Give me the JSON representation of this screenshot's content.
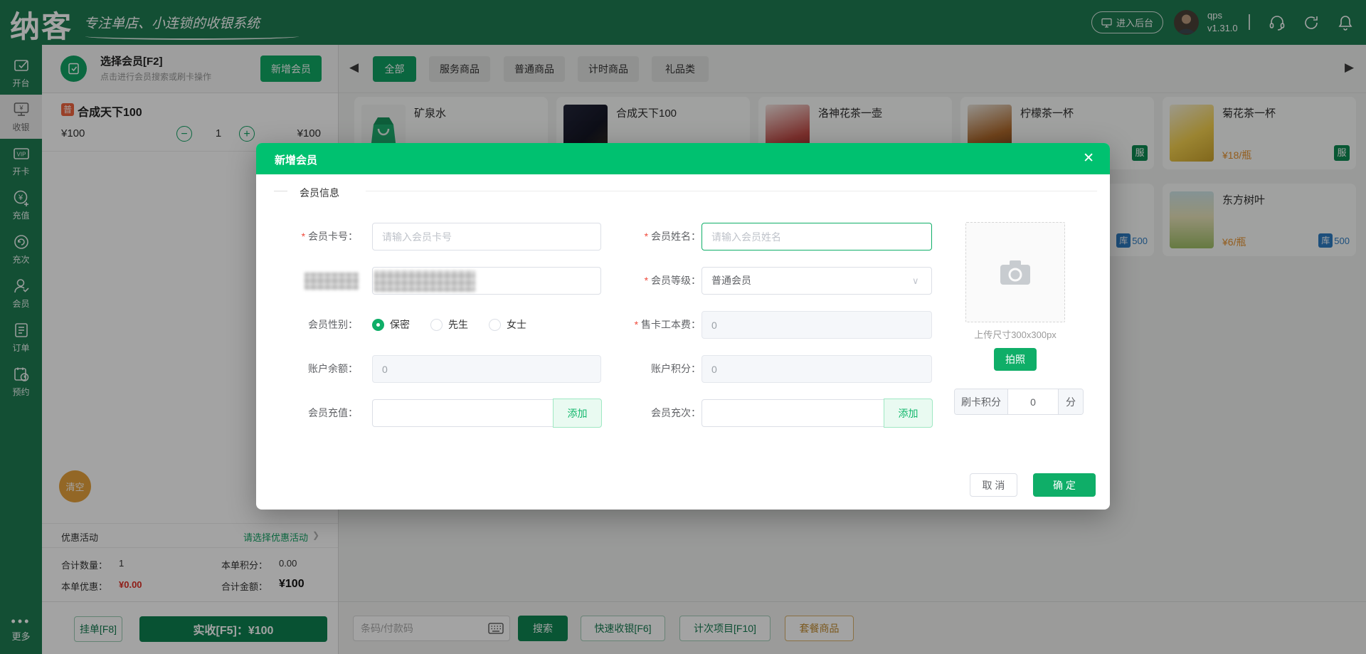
{
  "topbar": {
    "logo": "纳客",
    "tagline": "专注单店、小连锁的收银系统",
    "backstage": "进入后台",
    "user": "qps",
    "version": "v1.31.0"
  },
  "sidebar": {
    "items": [
      {
        "label": "开台"
      },
      {
        "label": "收银"
      },
      {
        "label": "开卡"
      },
      {
        "label": "充值"
      },
      {
        "label": "充次"
      },
      {
        "label": "会员"
      },
      {
        "label": "订单"
      },
      {
        "label": "预约"
      }
    ],
    "more": "更多"
  },
  "member_panel": {
    "title": "选择会员[F2]",
    "subtitle": "点击进行会员搜索或刷卡操作",
    "add_btn": "新增会员"
  },
  "cart": {
    "item": {
      "badge": "普",
      "name": "合成天下100",
      "price": "¥100",
      "qty": "1",
      "total": "¥100"
    },
    "clear": "清空"
  },
  "promo": {
    "label": "优惠活动",
    "link": "请选择优惠活动",
    "chevron": "❯"
  },
  "totals": {
    "qty_label": "合计数量：",
    "qty": "1",
    "points_label": "本单积分：",
    "points": "0.00",
    "discount_label": "本单优惠：",
    "discount": "¥0.00",
    "amount_label": "合计金额：",
    "amount": "¥100"
  },
  "actions": {
    "hold": "挂单[F8]",
    "charge": "实收[F5]：¥100"
  },
  "catalog": {
    "tabs": [
      "全部",
      "服务商品",
      "普通商品",
      "计时商品",
      "礼品类"
    ],
    "products": [
      {
        "name": "矿泉水"
      },
      {
        "name": "合成天下100"
      },
      {
        "name": "洛神花茶一壶"
      },
      {
        "name": "柠檬茶一杯",
        "badge": "服"
      },
      {
        "name": "菊花茶一杯",
        "price": "¥18/瓶",
        "badge": "服"
      },
      {
        "stock_badge": "库",
        "stock": "500"
      },
      {
        "name": "东方树叶",
        "price": "¥6/瓶",
        "stock_badge": "库",
        "stock": "500"
      }
    ]
  },
  "bottom_bar": {
    "scan_placeholder": "条码/付款码",
    "search": "搜索",
    "quick": "快速收银[F6]",
    "count": "计次项目[F10]",
    "combo": "套餐商品"
  },
  "modal": {
    "title": "新增会员",
    "section": "会员信息",
    "fields": {
      "card_label": "会员卡号：",
      "card_placeholder": "请输入会员卡号",
      "name_label": "会员姓名：",
      "name_placeholder": "请输入会员姓名",
      "level_label": "会员等级：",
      "level_value": "普通会员",
      "gender_label": "会员性别：",
      "gender_options": [
        "保密",
        "先生",
        "女士"
      ],
      "fee_label": "售卡工本费：",
      "fee_value": "0",
      "balance_label": "账户余额：",
      "balance_value": "0",
      "points_label": "账户积分：",
      "points_value": "0",
      "recharge_label": "会员充值：",
      "recharge_add": "添加",
      "times_label": "会员充次：",
      "times_add": "添加"
    },
    "photo": {
      "hint": "上传尺寸300x300px",
      "take": "拍照",
      "swipe_label": "刷卡积分",
      "swipe_value": "0",
      "swipe_unit": "分"
    },
    "cancel": "取 消",
    "confirm": "确 定"
  }
}
